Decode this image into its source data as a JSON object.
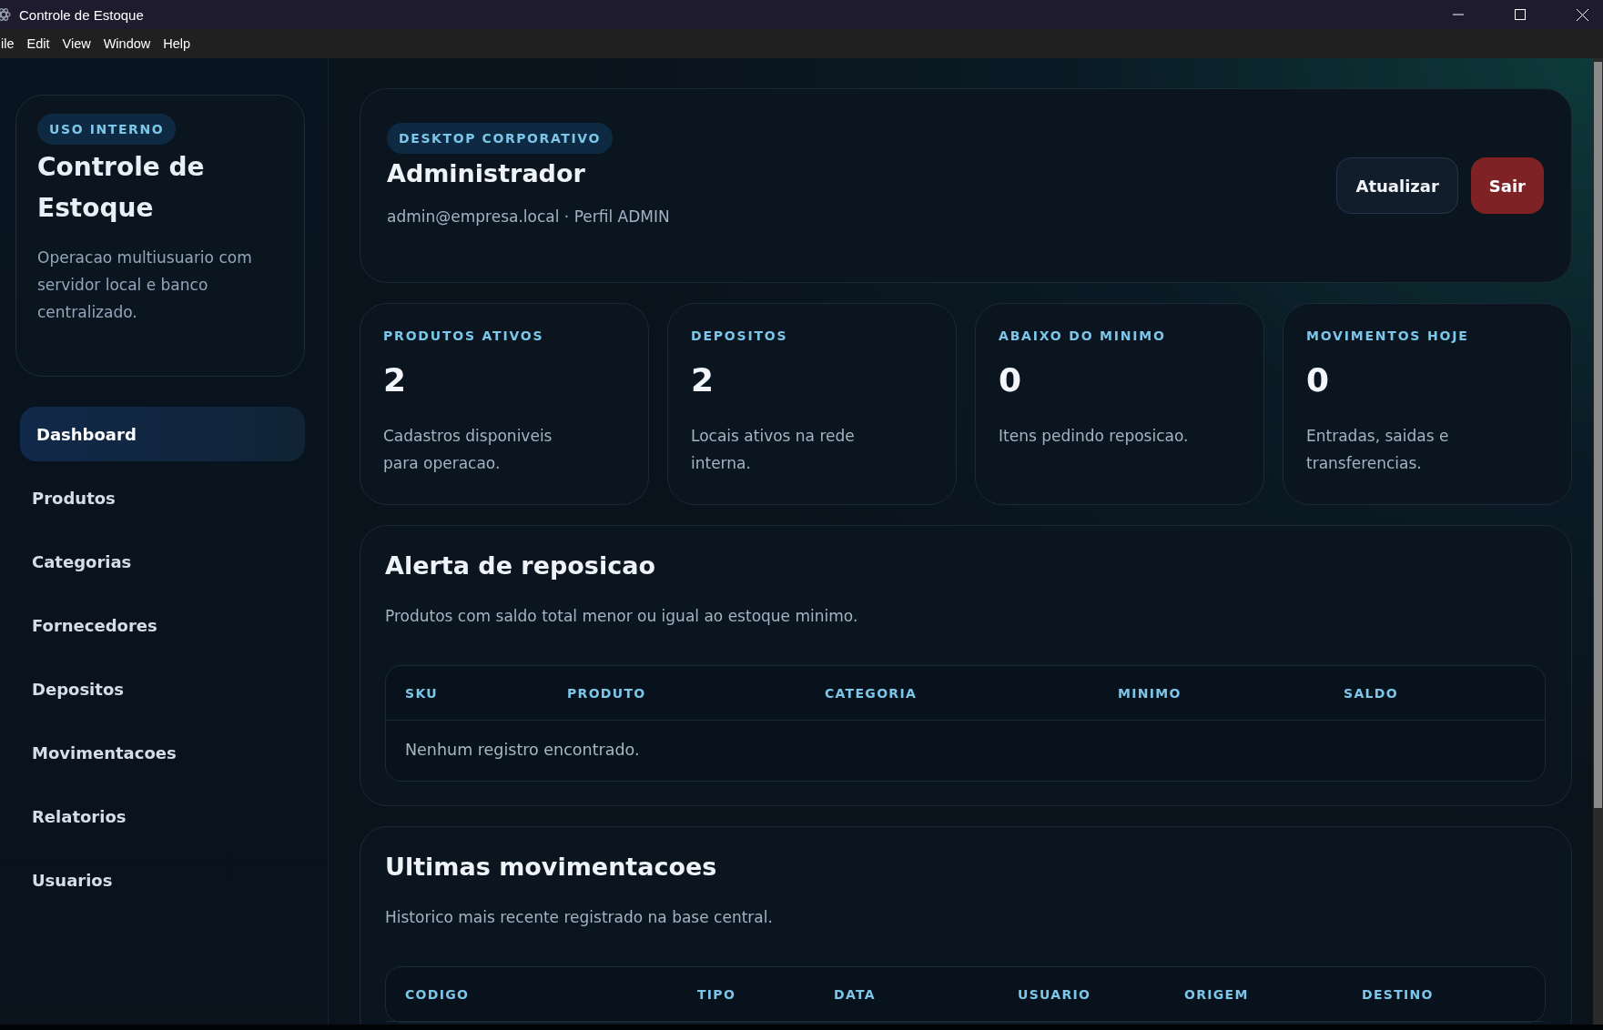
{
  "window": {
    "title": "Controle de Estoque"
  },
  "menu": [
    "ile",
    "Edit",
    "View",
    "Window",
    "Help"
  ],
  "sidebar": {
    "badge": "USO INTERNO",
    "title": "Controle de Estoque",
    "description": "Operacao multiusuario com servidor local e banco centralizado.",
    "nav": [
      {
        "label": "Dashboard",
        "selected": true
      },
      {
        "label": "Produtos",
        "selected": false
      },
      {
        "label": "Categorias",
        "selected": false
      },
      {
        "label": "Fornecedores",
        "selected": false
      },
      {
        "label": "Depositos",
        "selected": false
      },
      {
        "label": "Movimentacoes",
        "selected": false
      },
      {
        "label": "Relatorios",
        "selected": false
      },
      {
        "label": "Usuarios",
        "selected": false
      }
    ]
  },
  "header": {
    "badge": "DESKTOP CORPORATIVO",
    "name": "Administrador",
    "subtitle": "admin@empresa.local · Perfil ADMIN",
    "buttons": [
      {
        "label": "Atualizar",
        "kind": "secondary"
      },
      {
        "label": "Sair",
        "kind": "danger"
      }
    ]
  },
  "stats": [
    {
      "label": "PRODUTOS ATIVOS",
      "value": "2",
      "description": "Cadastros disponiveis para operacao."
    },
    {
      "label": "DEPOSITOS",
      "value": "2",
      "description": "Locais ativos na rede interna."
    },
    {
      "label": "ABAIXO DO MINIMO",
      "value": "0",
      "description": "Itens pedindo reposicao."
    },
    {
      "label": "MOVIMENTOS HOJE",
      "value": "0",
      "description": "Entradas, saidas e transferencias."
    }
  ],
  "sections": [
    {
      "title": "Alerta de reposicao",
      "description": "Produtos com saldo total menor ou igual ao estoque minimo.",
      "columns": [
        "SKU",
        "PRODUTO",
        "CATEGORIA",
        "MINIMO",
        "SALDO"
      ],
      "empty_message": "Nenhum registro encontrado."
    },
    {
      "title": "Ultimas movimentacoes",
      "description": "Historico mais recente registrado na base central.",
      "columns": [
        "CODIGO",
        "TIPO",
        "DATA",
        "USUARIO",
        "ORIGEM",
        "DESTINO"
      ]
    }
  ]
}
